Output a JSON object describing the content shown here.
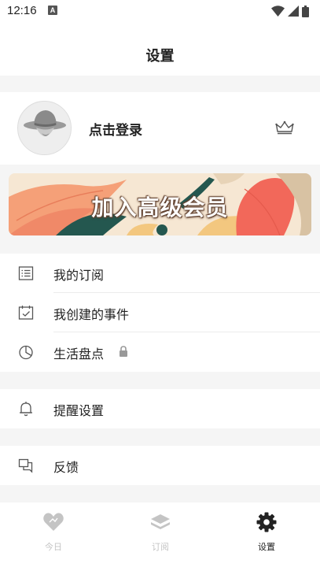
{
  "status_bar": {
    "time": "12:16",
    "notification_badge": "A",
    "icons": [
      "wifi-icon",
      "signal-icon",
      "battery-icon"
    ]
  },
  "header": {
    "title": "设置"
  },
  "profile": {
    "login_label": "点击登录",
    "avatar_icon": "avatar-hat-icon",
    "vip_icon": "crown-icon"
  },
  "banner": {
    "text": "加入高级会员"
  },
  "menu_group_1": [
    {
      "label": "我的订阅",
      "icon": "list-icon"
    },
    {
      "label": "我创建的事件",
      "icon": "calendar-check-icon"
    },
    {
      "label": "生活盘点",
      "icon": "pie-chart-icon",
      "locked": true
    }
  ],
  "menu_group_2": [
    {
      "label": "提醒设置",
      "icon": "bell-icon"
    }
  ],
  "menu_group_3": [
    {
      "label": "反馈",
      "icon": "feedback-icon"
    }
  ],
  "tabbar": [
    {
      "label": "今日",
      "icon": "heart-icon",
      "active": false
    },
    {
      "label": "订阅",
      "icon": "layers-icon",
      "active": false
    },
    {
      "label": "设置",
      "icon": "gear-icon",
      "active": true
    }
  ],
  "colors": {
    "active_tab": "#222222",
    "inactive_tab": "#c4c4c4",
    "background": "#f5f5f5"
  }
}
